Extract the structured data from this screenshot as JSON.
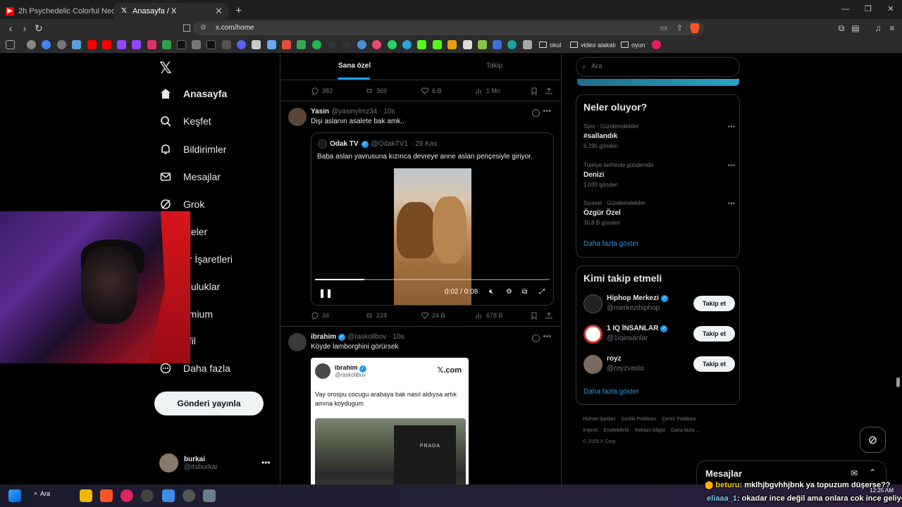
{
  "browser": {
    "tabs": [
      {
        "title": "2h Psychedelic Colorful Neon Backg",
        "icon": "youtube-icon"
      },
      {
        "title": "Anasayfa / X",
        "icon": "x-icon"
      }
    ],
    "url": "x.com/home",
    "bookmark_folders": [
      "okul",
      "video alakalı",
      "oyun"
    ]
  },
  "nav": {
    "items": [
      {
        "label": "Anasayfa",
        "icon": "home-icon"
      },
      {
        "label": "Keşfet",
        "icon": "search-icon"
      },
      {
        "label": "Bildirimler",
        "icon": "bell-icon"
      },
      {
        "label": "Mesajlar",
        "icon": "mail-icon"
      },
      {
        "label": "Grok",
        "icon": "grok-icon"
      },
      {
        "label": "steler",
        "icon": "list-icon"
      },
      {
        "label": "er İşaretleri",
        "icon": "bookmark-icon"
      },
      {
        "label": "pluluklar",
        "icon": "communities-icon"
      },
      {
        "label": "emium",
        "icon": "premium-icon"
      },
      {
        "label": "ofil",
        "icon": "profile-icon"
      },
      {
        "label": "Daha fazla",
        "icon": "more-icon"
      }
    ],
    "post_button": "Gönderi yayınla",
    "account": {
      "name": "burkai",
      "handle": "@itsburkai"
    }
  },
  "feed": {
    "tabs": [
      "Sana özel",
      "Takip"
    ],
    "prev_stats": {
      "replies": "382",
      "reposts": "369",
      "likes": "6 B",
      "views": "1 Mn"
    },
    "post1": {
      "name": "Yasin",
      "handle": "@yasinylmz34",
      "time": "· 10s",
      "text": "Dişi aslanın asalete bak amk..",
      "quote": {
        "name": "Odak TV",
        "handle": "@OdakTV1",
        "time": "· 29 Kas",
        "text": "Baba aslan yavrusuna kızınca devreye anne aslan pençesiyle giriyor."
      },
      "video_time": "0:02 / 0:08",
      "video_progress": 0.21,
      "stats": {
        "replies": "34",
        "reposts": "224",
        "likes": "24 B",
        "views": "678 B"
      }
    },
    "post2": {
      "name": "ibrahim",
      "handle": "@raskolibov",
      "time": "· 10s",
      "text": "Köyde lamborghini görürsek",
      "card": {
        "name": "ibrahim",
        "handle": "@raskolibov",
        "brand": "𝕏.com",
        "text": "Vay orospu cocugu arabaya bak nasıl aldıysa artık amına koydugum",
        "store_sign": "PRADA"
      }
    }
  },
  "right": {
    "search_placeholder": "Ara",
    "trends_title": "Neler oluyor?",
    "trends": [
      {
        "category": "Spor · Gündemdekiler",
        "name": "#sallandık",
        "count": "6.295 gönderi"
      },
      {
        "category": "Türkiye tarihinde gündemde",
        "name": "Denizi",
        "count": "1.035 gönderi"
      },
      {
        "category": "Siyaset · Gündemdekiler",
        "name": "Özgür Özel",
        "count": "30,8 B gönderi"
      }
    ],
    "show_more": "Daha fazla göster",
    "who_title": "Kimi takip etmeli",
    "who": [
      {
        "name": "Hiphop Merkezi",
        "handle": "@merkezihiphop",
        "verified": true,
        "button": "Takip et"
      },
      {
        "name": "1 IQ İNSANLAR",
        "handle": "@1iqinsanlar",
        "verified": true,
        "button": "Takip et"
      },
      {
        "name": "royz",
        "handle": "@royzvasto",
        "verified": false,
        "button": "Takip et"
      }
    ],
    "footer": [
      "Hizmet Şartları",
      "Gizlilik Politikası",
      "Çerez Politikası",
      "Imprint",
      "Erişilebilirlik",
      "Reklam bilgisi",
      "Daha fazla ...",
      "© 2025 X Corp."
    ]
  },
  "dock": {
    "title": "Mesajlar"
  },
  "taskbar": {
    "search": "Ara",
    "time": "12:25 AM"
  },
  "chat": [
    {
      "user": "beturu",
      "text": ": mklhjbgvhhjbnk ya topuzum düşerse??"
    },
    {
      "user": "eliaaa_1",
      "text": ": okadar ince değil ama onlara cok ince geliyo"
    }
  ],
  "colors": {
    "accent": "#1d9bf0",
    "bg": "#000000",
    "border": "#2f3336",
    "muted": "#71767b"
  }
}
